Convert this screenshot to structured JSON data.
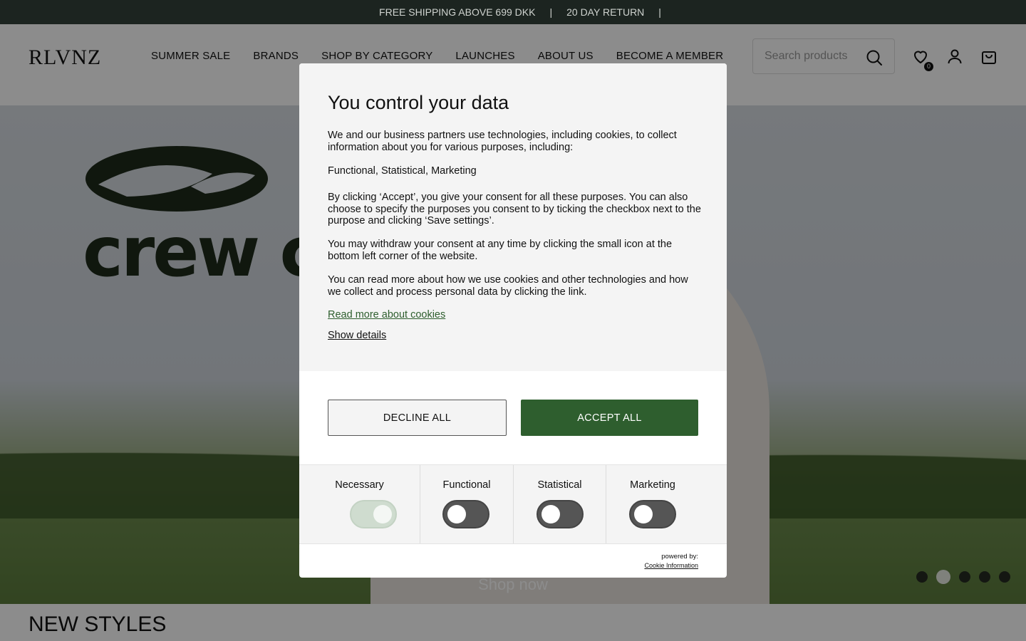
{
  "topbar": {
    "shipping": "FREE SHIPPING ABOVE 699 DKK",
    "separator": "|",
    "returns": "20 DAY RETURN"
  },
  "header": {
    "logo": "RLVNZ",
    "nav": [
      "SUMMER SALE",
      "BRANDS",
      "SHOP BY CATEGORY",
      "LAUNCHES",
      "ABOUT US",
      "BECOME A MEMBER"
    ],
    "search_placeholder": "Search products",
    "wishlist_count": "0",
    "icons": [
      "search-icon",
      "heart-icon",
      "user-icon",
      "bag-icon"
    ]
  },
  "hero": {
    "brand_text": "crew ctr",
    "cta": "Shop now",
    "slides": 5,
    "active_slide": 2
  },
  "section_title": "NEW STYLES",
  "consent": {
    "title": "You control your data",
    "p1": "We and our business partners use technologies, including cookies, to collect information about you for various purposes, including:",
    "p2": "Functional, Statistical, Marketing",
    "p3": "By clicking ‘Accept’, you give your consent for all these purposes. You can also choose to specify the purposes you consent to by ticking the checkbox next to the purpose and clicking ‘Save settings’.",
    "p4": "You may withdraw your consent at any time by clicking the small icon at the bottom left corner of the website.",
    "p5": "You can read more about how we use cookies and other technologies and how we collect and process personal data by clicking the link.",
    "read_more": "Read more about cookies",
    "show_details": "Show details",
    "decline": "DECLINE ALL",
    "accept": "ACCEPT ALL",
    "categories": [
      {
        "label": "Necessary",
        "on": true
      },
      {
        "label": "Functional",
        "on": false
      },
      {
        "label": "Statistical",
        "on": false
      },
      {
        "label": "Marketing",
        "on": false
      }
    ],
    "powered_by": "powered by:",
    "powered_link": "Cookie Information"
  },
  "colors": {
    "accent_green": "#2e5e2e",
    "topbar_bg": "#1c2420",
    "link_green": "#2e5e2e"
  }
}
